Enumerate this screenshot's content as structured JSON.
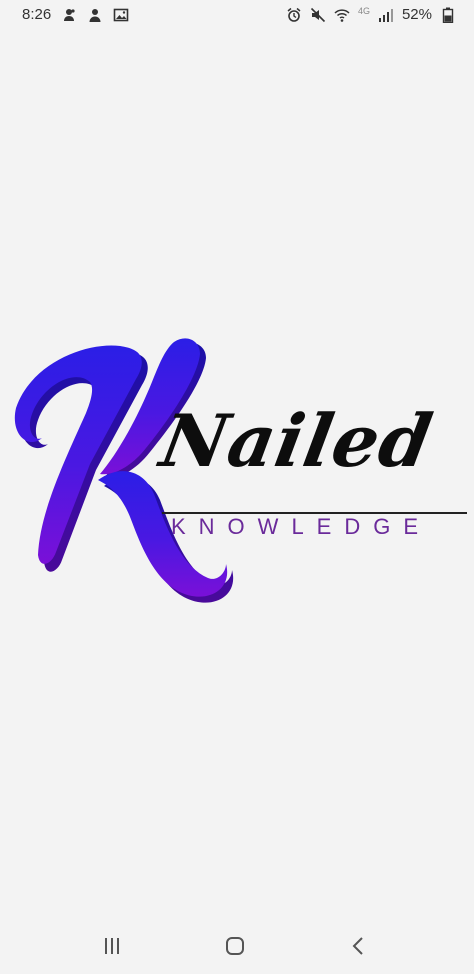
{
  "status_bar": {
    "time": "8:26",
    "network": "4G",
    "battery": "52%",
    "left_icons": [
      "app-notification-icon",
      "person-icon",
      "image-icon"
    ],
    "right_icons": [
      "alarm-icon",
      "mute-icon",
      "wifi-icon",
      "signal-icon",
      "battery-icon"
    ]
  },
  "logo": {
    "initial": "K",
    "word": "Nailed",
    "subtitle": "KNOWLEDGE",
    "initial_gradient": [
      "#2b1ee6",
      "#7a10d8"
    ],
    "word_color": "#0d0d0d",
    "subtitle_color": "#6a2a9a"
  },
  "nav_bar": {
    "buttons": [
      "recents-icon",
      "home-icon",
      "back-icon"
    ]
  }
}
